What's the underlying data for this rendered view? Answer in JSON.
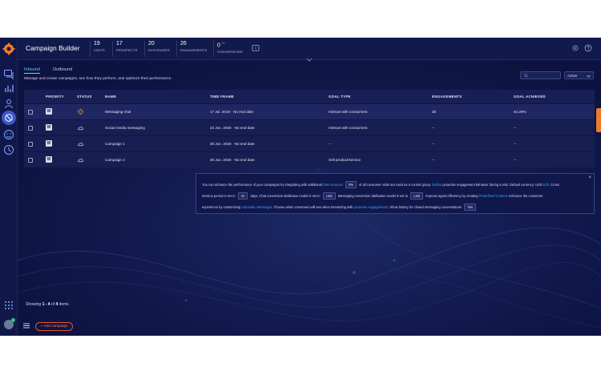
{
  "header": {
    "title": "Campaign Builder",
    "stats": [
      {
        "value": "19",
        "label": "VISITS",
        "sup": ""
      },
      {
        "value": "17",
        "label": "PROSPECTS",
        "sup": ""
      },
      {
        "value": "20",
        "label": "EXPOSURES",
        "sup": ""
      },
      {
        "value": "26",
        "label": "ENGAGEMENTS",
        "sup": ""
      },
      {
        "value": "0",
        "label": "CONVERSIONS",
        "sup": "+0"
      }
    ]
  },
  "tabs": {
    "inbound": "Inbound",
    "outbound": "Outbound"
  },
  "subtitle": "Manage and create campaigns, see how they perform, and optimize their performance.",
  "filter": {
    "selected": "Active"
  },
  "table": {
    "columns": [
      "PRIORITY",
      "STATUS",
      "NAME",
      "TIME FRAME",
      "GOAL TYPE",
      "ENGAGEMENTS",
      "GOAL ACHIEVED"
    ],
    "rows": [
      {
        "priority": "M",
        "status_icon": "sun-icon",
        "name": "Messaging-chat",
        "time_frame": "17 Jul. 2019 · No end date",
        "goal_type": "Interact with consumers",
        "engagements": "26",
        "goal_achieved": "64.29%"
      },
      {
        "priority": "M",
        "status_icon": "cloud-icon",
        "name": "Social media messaging",
        "time_frame": "23 Jun. 2020 · No end date",
        "goal_type": "Interact with consumers",
        "engagements": "--",
        "goal_achieved": "--"
      },
      {
        "priority": "M",
        "status_icon": "cloud-icon",
        "name": "Campaign 1",
        "time_frame": "30 Jun. 2020 · No end date",
        "goal_type": "--",
        "engagements": "--",
        "goal_achieved": "--"
      },
      {
        "priority": "M",
        "status_icon": "cloud-icon",
        "name": "Campaign 2",
        "time_frame": "30 Jun. 2020 · No end date",
        "goal_type": "Sell product/service",
        "engagements": "--",
        "goal_achieved": "--"
      }
    ]
  },
  "info": {
    "close": "×",
    "l1_a": "You can enhance the performance of your campaigns by integrating with additional",
    "l1_link1": "Data Sources",
    "l1_select": "0%",
    "l1_b": "of all consumer visits are used as a control group.",
    "l1_link2": "Define",
    "l1_c": "proactive engagement behavior during a visit. Default currency: USD",
    "l1_link3": "Edit",
    "l1_d": ". Cross",
    "l2_a": "session period is set to",
    "l2_select1": "31",
    "l2_b": "days. Chat conversion attribution model is set to",
    "l2_select2": "Last",
    "l2_c": "Messaging conversion attribution model is set to",
    "l2_select3": "Last",
    "l2_d": "Improve agent efficiency by creating",
    "l2_link": "Predefined Content",
    "l2_e": ". Enhance the consumer",
    "l3_a": "experience by customizing",
    "l3_link1": "Automatic Messages",
    "l3_b": ". Choose what consumers will see when interacting with",
    "l3_link2": "proactive engagements",
    "l3_c": ". Show history for closed messaging conversations",
    "l3_select": "Yes"
  },
  "footer": {
    "prefix": "Showing",
    "range": "1 - 4",
    "middle": "of",
    "total": "4",
    "suffix": "items"
  },
  "add_campaign": "+ Add campaign"
}
